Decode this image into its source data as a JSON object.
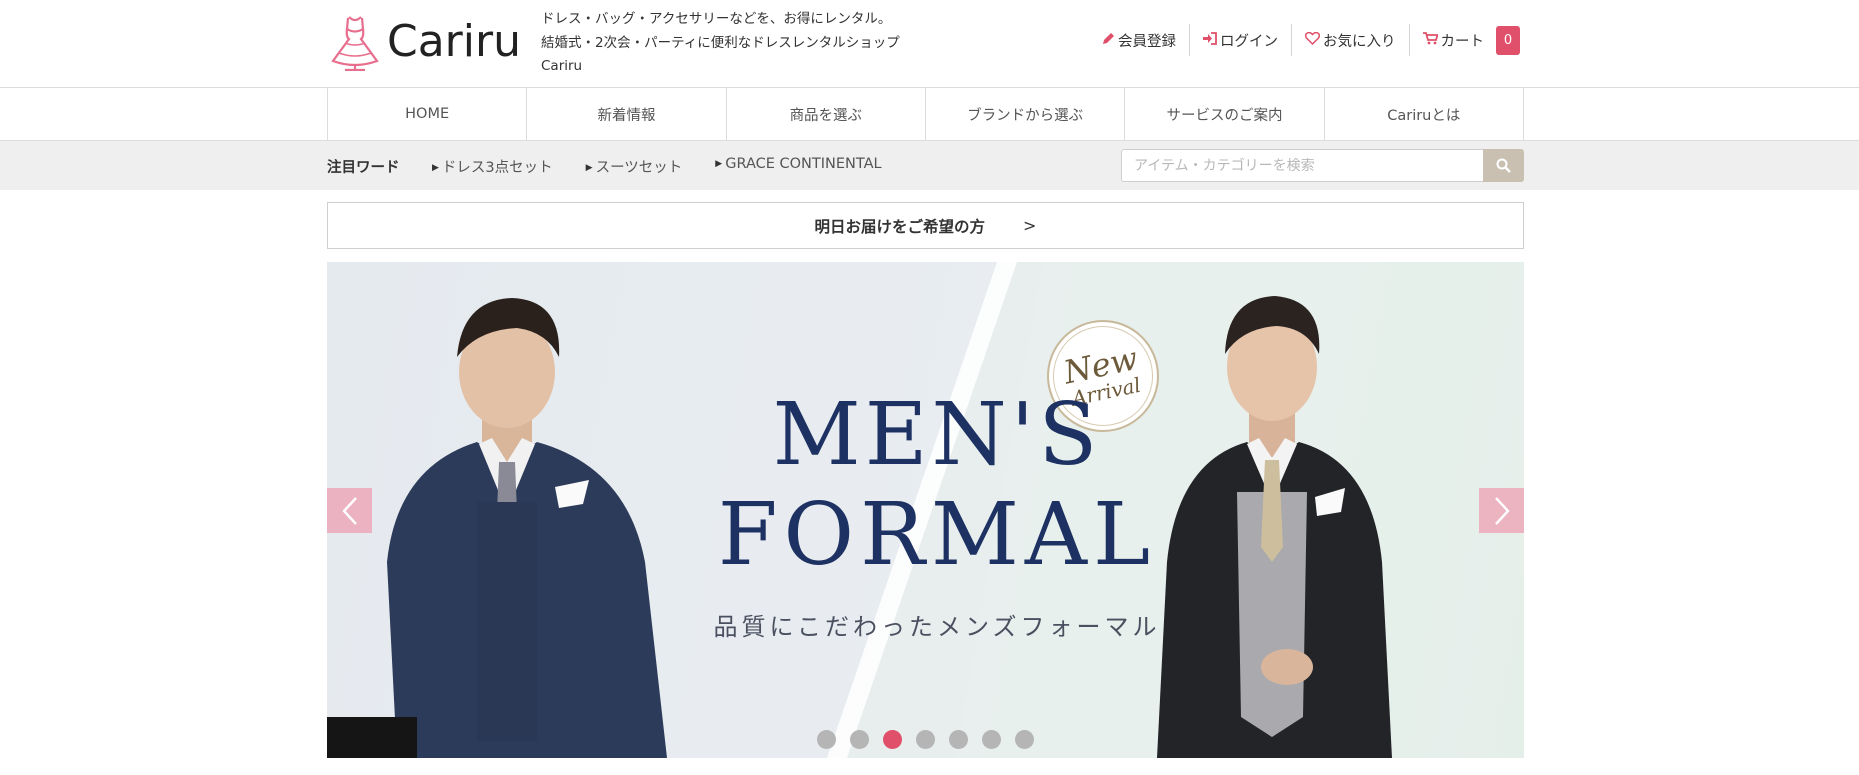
{
  "header": {
    "logo_text": "Cariru",
    "tagline": [
      "ドレス・バッグ・アクセサリーなどを、お得にレンタル。",
      "結婚式・2次会・パーティに便利なドレスレンタルショップ",
      "Cariru"
    ],
    "links": {
      "register": "会員登録",
      "login": "ログイン",
      "favorites": "お気に入り",
      "cart": "カート",
      "cart_count": "0"
    }
  },
  "nav": {
    "items": [
      "HOME",
      "新着情報",
      "商品を選ぶ",
      "ブランドから選ぶ",
      "サービスのご案内",
      "Cariruとは"
    ]
  },
  "hot": {
    "title": "注目ワード",
    "words": [
      "ドレス3点セット",
      "スーツセット",
      "GRACE CONTINENTAL"
    ]
  },
  "search": {
    "placeholder": "アイテム・カテゴリーを検索"
  },
  "delivery": {
    "label": "明日お届けをご希望の方",
    "arrow": ">"
  },
  "banner": {
    "title_line1": "MEN'S",
    "title_line2": "FORMAL",
    "subtitle": "品質にこだわったメンズフォーマル",
    "badge_line1": "New",
    "badge_line2": "Arrival",
    "slide_count": 7,
    "active_slide": 3
  },
  "colors": {
    "accent": "#e0506a",
    "navy": "#1d3263",
    "search_button": "#c9c0b2"
  }
}
